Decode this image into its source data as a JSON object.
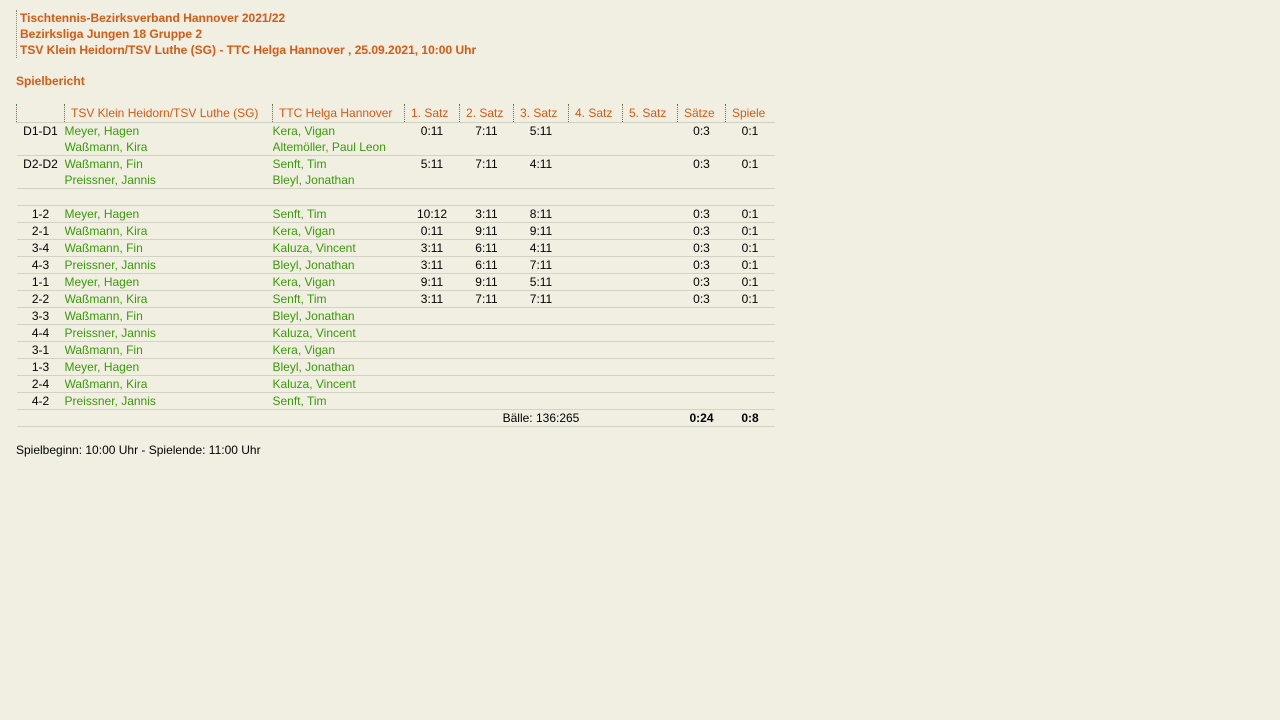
{
  "header": {
    "line1": "Tischtennis-Bezirksverband Hannover 2021/22",
    "line2": "Bezirksliga Jungen 18 Gruppe 2",
    "line3": "TSV Klein Heidorn/TSV Luthe (SG) - TTC Helga Hannover , 25.09.2021, 10:00 Uhr"
  },
  "report_label": "Spielbericht",
  "table": {
    "columns": [
      "",
      "TSV Klein Heidorn/TSV Luthe (SG)",
      "TTC Helga Hannover",
      "1. Satz",
      "2. Satz",
      "3. Satz",
      "4. Satz",
      "5. Satz",
      "Sätze",
      "Spiele"
    ],
    "doubles": [
      {
        "nr": "D1-D1",
        "home1": "Meyer, Hagen",
        "home2": "Waßmann, Kira",
        "guest1": "Kera, Vigan",
        "guest2": "Altemöller, Paul Leon",
        "s1": "0:11",
        "s2": "7:11",
        "s3": "5:11",
        "s4": "",
        "s5": "",
        "saetze": "0:3",
        "spiele": "0:1"
      },
      {
        "nr": "D2-D2",
        "home1": "Waßmann, Fin",
        "home2": "Preissner, Jannis",
        "guest1": "Senft, Tim",
        "guest2": "Bleyl, Jonathan",
        "s1": "5:11",
        "s2": "7:11",
        "s3": "4:11",
        "s4": "",
        "s5": "",
        "saetze": "0:3",
        "spiele": "0:1"
      }
    ],
    "singles": [
      {
        "nr": "1-2",
        "home": "Meyer, Hagen",
        "guest": "Senft, Tim",
        "s1": "10:12",
        "s2": "3:11",
        "s3": "8:11",
        "s4": "",
        "s5": "",
        "saetze": "0:3",
        "spiele": "0:1"
      },
      {
        "nr": "2-1",
        "home": "Waßmann, Kira",
        "guest": "Kera, Vigan",
        "s1": "0:11",
        "s2": "9:11",
        "s3": "9:11",
        "s4": "",
        "s5": "",
        "saetze": "0:3",
        "spiele": "0:1"
      },
      {
        "nr": "3-4",
        "home": "Waßmann, Fin",
        "guest": "Kaluza, Vincent",
        "s1": "3:11",
        "s2": "6:11",
        "s3": "4:11",
        "s4": "",
        "s5": "",
        "saetze": "0:3",
        "spiele": "0:1"
      },
      {
        "nr": "4-3",
        "home": "Preissner, Jannis",
        "guest": "Bleyl, Jonathan",
        "s1": "3:11",
        "s2": "6:11",
        "s3": "7:11",
        "s4": "",
        "s5": "",
        "saetze": "0:3",
        "spiele": "0:1"
      },
      {
        "nr": "1-1",
        "home": "Meyer, Hagen",
        "guest": "Kera, Vigan",
        "s1": "9:11",
        "s2": "9:11",
        "s3": "5:11",
        "s4": "",
        "s5": "",
        "saetze": "0:3",
        "spiele": "0:1"
      },
      {
        "nr": "2-2",
        "home": "Waßmann, Kira",
        "guest": "Senft, Tim",
        "s1": "3:11",
        "s2": "7:11",
        "s3": "7:11",
        "s4": "",
        "s5": "",
        "saetze": "0:3",
        "spiele": "0:1"
      },
      {
        "nr": "3-3",
        "home": "Waßmann, Fin",
        "guest": "Bleyl, Jonathan",
        "s1": "",
        "s2": "",
        "s3": "",
        "s4": "",
        "s5": "",
        "saetze": "",
        "spiele": ""
      },
      {
        "nr": "4-4",
        "home": "Preissner, Jannis",
        "guest": "Kaluza, Vincent",
        "s1": "",
        "s2": "",
        "s3": "",
        "s4": "",
        "s5": "",
        "saetze": "",
        "spiele": ""
      },
      {
        "nr": "3-1",
        "home": "Waßmann, Fin",
        "guest": "Kera, Vigan",
        "s1": "",
        "s2": "",
        "s3": "",
        "s4": "",
        "s5": "",
        "saetze": "",
        "spiele": ""
      },
      {
        "nr": "1-3",
        "home": "Meyer, Hagen",
        "guest": "Bleyl, Jonathan",
        "s1": "",
        "s2": "",
        "s3": "",
        "s4": "",
        "s5": "",
        "saetze": "",
        "spiele": ""
      },
      {
        "nr": "2-4",
        "home": "Waßmann, Kira",
        "guest": "Kaluza, Vincent",
        "s1": "",
        "s2": "",
        "s3": "",
        "s4": "",
        "s5": "",
        "saetze": "",
        "spiele": ""
      },
      {
        "nr": "4-2",
        "home": "Preissner, Jannis",
        "guest": "Senft, Tim",
        "s1": "",
        "s2": "",
        "s3": "",
        "s4": "",
        "s5": "",
        "saetze": "",
        "spiele": ""
      }
    ],
    "totals": {
      "balls": "Bälle: 136:265",
      "saetze": "0:24",
      "spiele": "0:8"
    }
  },
  "footer": "Spielbeginn: 10:00 Uhr - Spielende: 11:00 Uhr",
  "colors": {
    "accent": "#d65a14",
    "player": "#3a9a0a",
    "background": "#f0efe2"
  }
}
